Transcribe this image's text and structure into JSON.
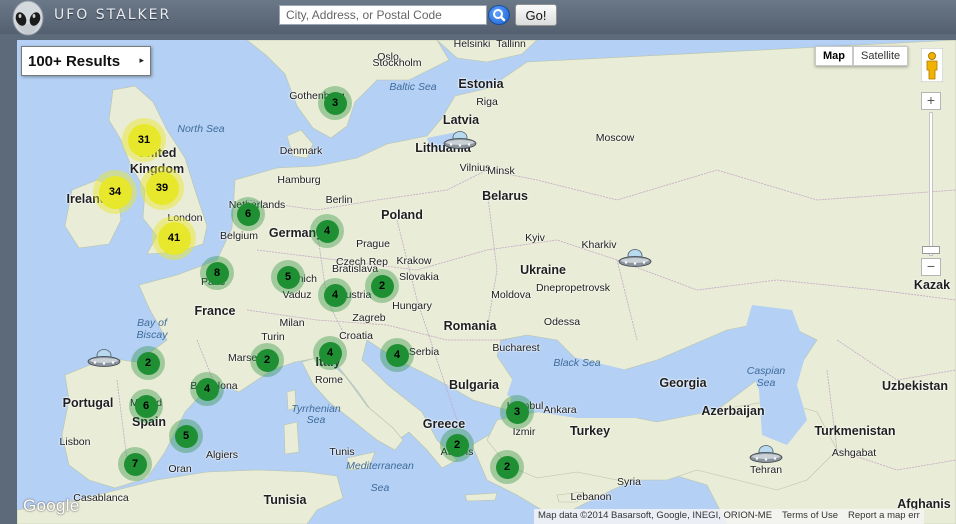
{
  "header": {
    "logo_text": "UFO STALKER",
    "search_placeholder": "City, Address, or Postal Code",
    "search_value": "",
    "go_label": "Go!"
  },
  "results_panel": {
    "label": "100+ Results",
    "arrow": "▸"
  },
  "map_controls": {
    "map_label": "Map",
    "satellite_label": "Satellite",
    "selected": "Map",
    "zoom_in": "+",
    "zoom_out": "−"
  },
  "attribution": {
    "google": "Google",
    "map_data": "Map data ©2014 Basarsoft, Google, INEGI, ORION-ME",
    "terms": "Terms of Use",
    "report": "Report a map err"
  },
  "map_labels": [
    {
      "text": "Helsinki",
      "kind": "city"
    },
    {
      "text": "Tallinn",
      "kind": "city"
    },
    {
      "text": "Oslo",
      "kind": "city"
    },
    {
      "text": "Stockholm",
      "kind": "city"
    },
    {
      "text": "Estonia",
      "kind": "country"
    },
    {
      "text": "Baltic Sea",
      "kind": "sea"
    },
    {
      "text": "Riga",
      "kind": "city"
    },
    {
      "text": "Gothenburg",
      "kind": "city"
    },
    {
      "text": "Latvia",
      "kind": "country"
    },
    {
      "text": "North Sea",
      "kind": "sea"
    },
    {
      "text": "Moscow",
      "kind": "city"
    },
    {
      "text": "Denmark",
      "kind": "city"
    },
    {
      "text": "Lithuania",
      "kind": "country"
    },
    {
      "text": "United",
      "kind": "country"
    },
    {
      "text": "Kingdom",
      "kind": "country"
    },
    {
      "text": "Vilnius",
      "kind": "city"
    },
    {
      "text": "Minsk",
      "kind": "city"
    },
    {
      "text": "Ireland",
      "kind": "country"
    },
    {
      "text": "Hamburg",
      "kind": "city"
    },
    {
      "text": "Belarus",
      "kind": "country"
    },
    {
      "text": "Netherlands",
      "kind": "city"
    },
    {
      "text": "Berlin",
      "kind": "city"
    },
    {
      "text": "London",
      "kind": "city"
    },
    {
      "text": "Poland",
      "kind": "country"
    },
    {
      "text": "Belgium",
      "kind": "city"
    },
    {
      "text": "Germany",
      "kind": "country"
    },
    {
      "text": "Prague",
      "kind": "city"
    },
    {
      "text": "Kyiv",
      "kind": "city"
    },
    {
      "text": "Kharkiv",
      "kind": "city"
    },
    {
      "text": "Czech Rep",
      "kind": "city"
    },
    {
      "text": "Krakow",
      "kind": "city"
    },
    {
      "text": "Ukraine",
      "kind": "country"
    },
    {
      "text": "Paris",
      "kind": "city"
    },
    {
      "text": "Munich",
      "kind": "city"
    },
    {
      "text": "Bratislava",
      "kind": "city"
    },
    {
      "text": "Slovakia",
      "kind": "city"
    },
    {
      "text": "Kazak",
      "kind": "country"
    },
    {
      "text": "Dnepropetrovsk",
      "kind": "city"
    },
    {
      "text": "Vaduz",
      "kind": "city"
    },
    {
      "text": "Austria",
      "kind": "city"
    },
    {
      "text": "Moldova",
      "kind": "city"
    },
    {
      "text": "France",
      "kind": "country"
    },
    {
      "text": "Hungary",
      "kind": "city"
    },
    {
      "text": "Milan",
      "kind": "city"
    },
    {
      "text": "Zagreb",
      "kind": "city"
    },
    {
      "text": "Bay of",
      "kind": "sea"
    },
    {
      "text": "Biscay",
      "kind": "sea"
    },
    {
      "text": "Odessa",
      "kind": "city"
    },
    {
      "text": "Romania",
      "kind": "country"
    },
    {
      "text": "Turin",
      "kind": "city"
    },
    {
      "text": "Croatia",
      "kind": "city"
    },
    {
      "text": "Bucharest",
      "kind": "city"
    },
    {
      "text": "Serbia",
      "kind": "city"
    },
    {
      "text": "Marseille",
      "kind": "city"
    },
    {
      "text": "Italy",
      "kind": "country"
    },
    {
      "text": "Black Sea",
      "kind": "sea"
    },
    {
      "text": "Caspian",
      "kind": "sea"
    },
    {
      "text": "Sea",
      "kind": "sea"
    },
    {
      "text": "Bulgaria",
      "kind": "country"
    },
    {
      "text": "Georgia",
      "kind": "country"
    },
    {
      "text": "Uzbekistan",
      "kind": "country"
    },
    {
      "text": "Rome",
      "kind": "city"
    },
    {
      "text": "Barcelona",
      "kind": "city"
    },
    {
      "text": "Portugal",
      "kind": "country"
    },
    {
      "text": "Madrid",
      "kind": "city"
    },
    {
      "text": "Istanbul",
      "kind": "city"
    },
    {
      "text": "Ankara",
      "kind": "city"
    },
    {
      "text": "Azerbaijan",
      "kind": "country"
    },
    {
      "text": "Tyrrhenian",
      "kind": "sea"
    },
    {
      "text": "Sea",
      "kind": "sea"
    },
    {
      "text": "Spain",
      "kind": "country"
    },
    {
      "text": "Greece",
      "kind": "country"
    },
    {
      "text": "Turkey",
      "kind": "country"
    },
    {
      "text": "Turkmenistan",
      "kind": "country"
    },
    {
      "text": "Lisbon",
      "kind": "city"
    },
    {
      "text": "Izmir",
      "kind": "city"
    },
    {
      "text": "Athens",
      "kind": "city"
    },
    {
      "text": "Ashgabat",
      "kind": "city"
    },
    {
      "text": "Algiers",
      "kind": "city"
    },
    {
      "text": "Tunis",
      "kind": "city"
    },
    {
      "text": "Tehran",
      "kind": "city"
    },
    {
      "text": "Oran",
      "kind": "city"
    },
    {
      "text": "Mediterranean",
      "kind": "sea"
    },
    {
      "text": "Sea",
      "kind": "sea"
    },
    {
      "text": "Syria",
      "kind": "city"
    },
    {
      "text": "Tunisia",
      "kind": "country"
    },
    {
      "text": "Casablanca",
      "kind": "city"
    },
    {
      "text": "Lebanon",
      "kind": "city"
    },
    {
      "text": "Afghanis",
      "kind": "country"
    }
  ],
  "clusters": [
    {
      "count": "3",
      "tier": "green"
    },
    {
      "count": "31",
      "tier": "yellow"
    },
    {
      "count": "39",
      "tier": "yellow"
    },
    {
      "count": "34",
      "tier": "yellow"
    },
    {
      "count": "6",
      "tier": "green"
    },
    {
      "count": "4",
      "tier": "green"
    },
    {
      "count": "41",
      "tier": "yellow"
    },
    {
      "count": "8",
      "tier": "green"
    },
    {
      "count": "5",
      "tier": "green"
    },
    {
      "count": "4",
      "tier": "green"
    },
    {
      "count": "2",
      "tier": "green"
    },
    {
      "count": "2",
      "tier": "green"
    },
    {
      "count": "2",
      "tier": "green"
    },
    {
      "count": "4",
      "tier": "green"
    },
    {
      "count": "4",
      "tier": "green"
    },
    {
      "count": "4",
      "tier": "green"
    },
    {
      "count": "6",
      "tier": "green"
    },
    {
      "count": "3",
      "tier": "green"
    },
    {
      "count": "5",
      "tier": "green"
    },
    {
      "count": "2",
      "tier": "green"
    },
    {
      "count": "7",
      "tier": "green"
    },
    {
      "count": "2",
      "tier": "green"
    }
  ],
  "ufo_markers": [
    {
      "icon": "ufo-icon"
    },
    {
      "icon": "ufo-icon"
    },
    {
      "icon": "ufo-icon"
    },
    {
      "icon": "ufo-icon"
    }
  ],
  "colors": {
    "header": "#5d6a7a",
    "water": "#b4d0f4",
    "land": "#e8ecd5",
    "cluster_green": "#1e8f33",
    "cluster_yellow": "#e7e72b"
  }
}
